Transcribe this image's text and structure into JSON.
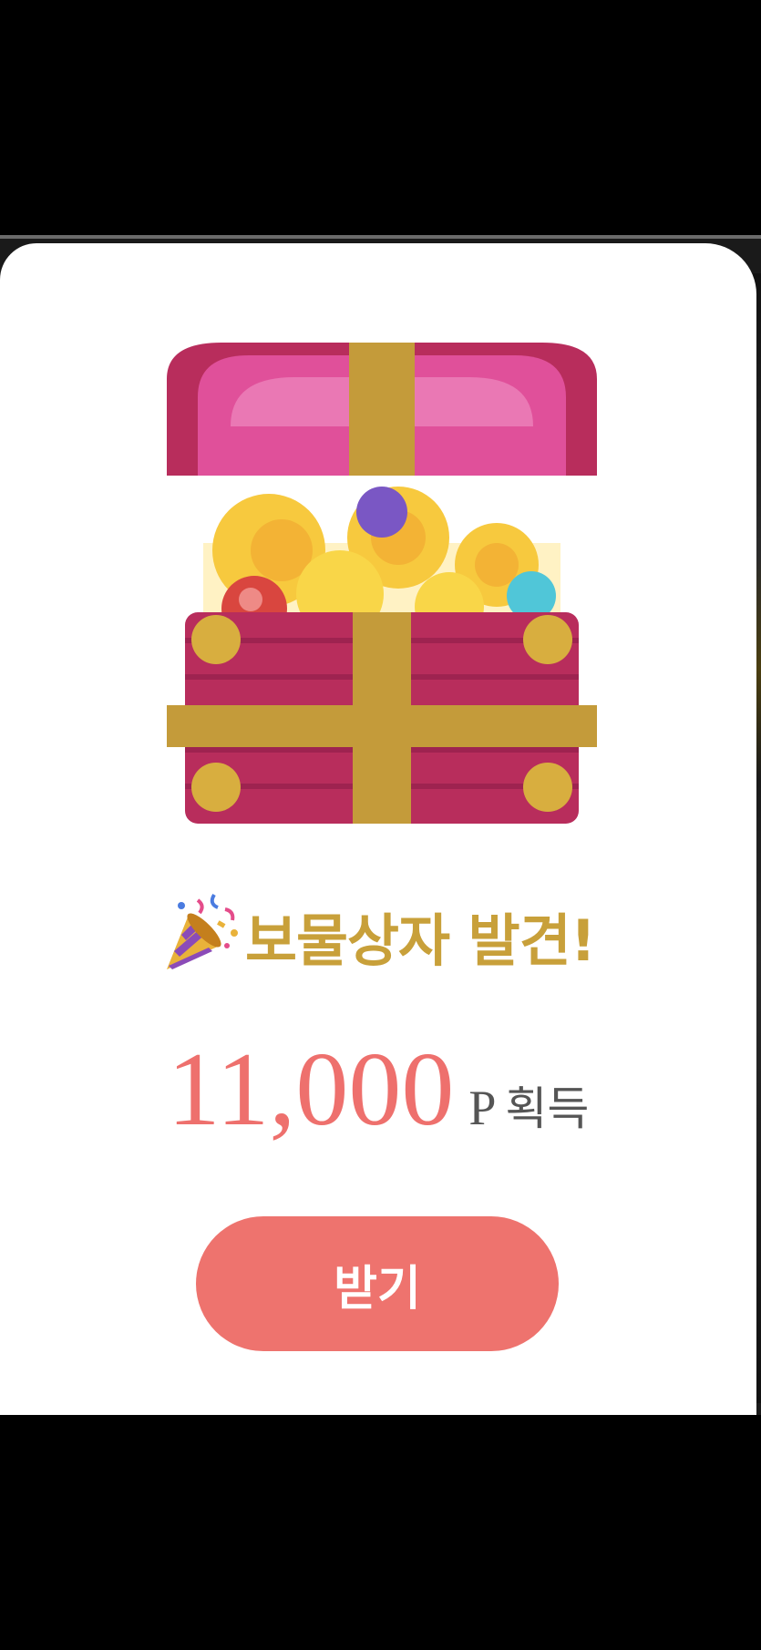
{
  "modal": {
    "title": "보물상자 발견!",
    "title_icon": "party-popper-icon",
    "reward_amount": "11,000",
    "reward_unit": "P",
    "reward_suffix": "획득",
    "button_label": "받기"
  },
  "colors": {
    "title": "#c8a03a",
    "amount": "#ee706d",
    "button": "#ee736e",
    "chest_body": "#b82d5c",
    "chest_lid": "#e0509a",
    "ribbon": "#c49b3a"
  }
}
